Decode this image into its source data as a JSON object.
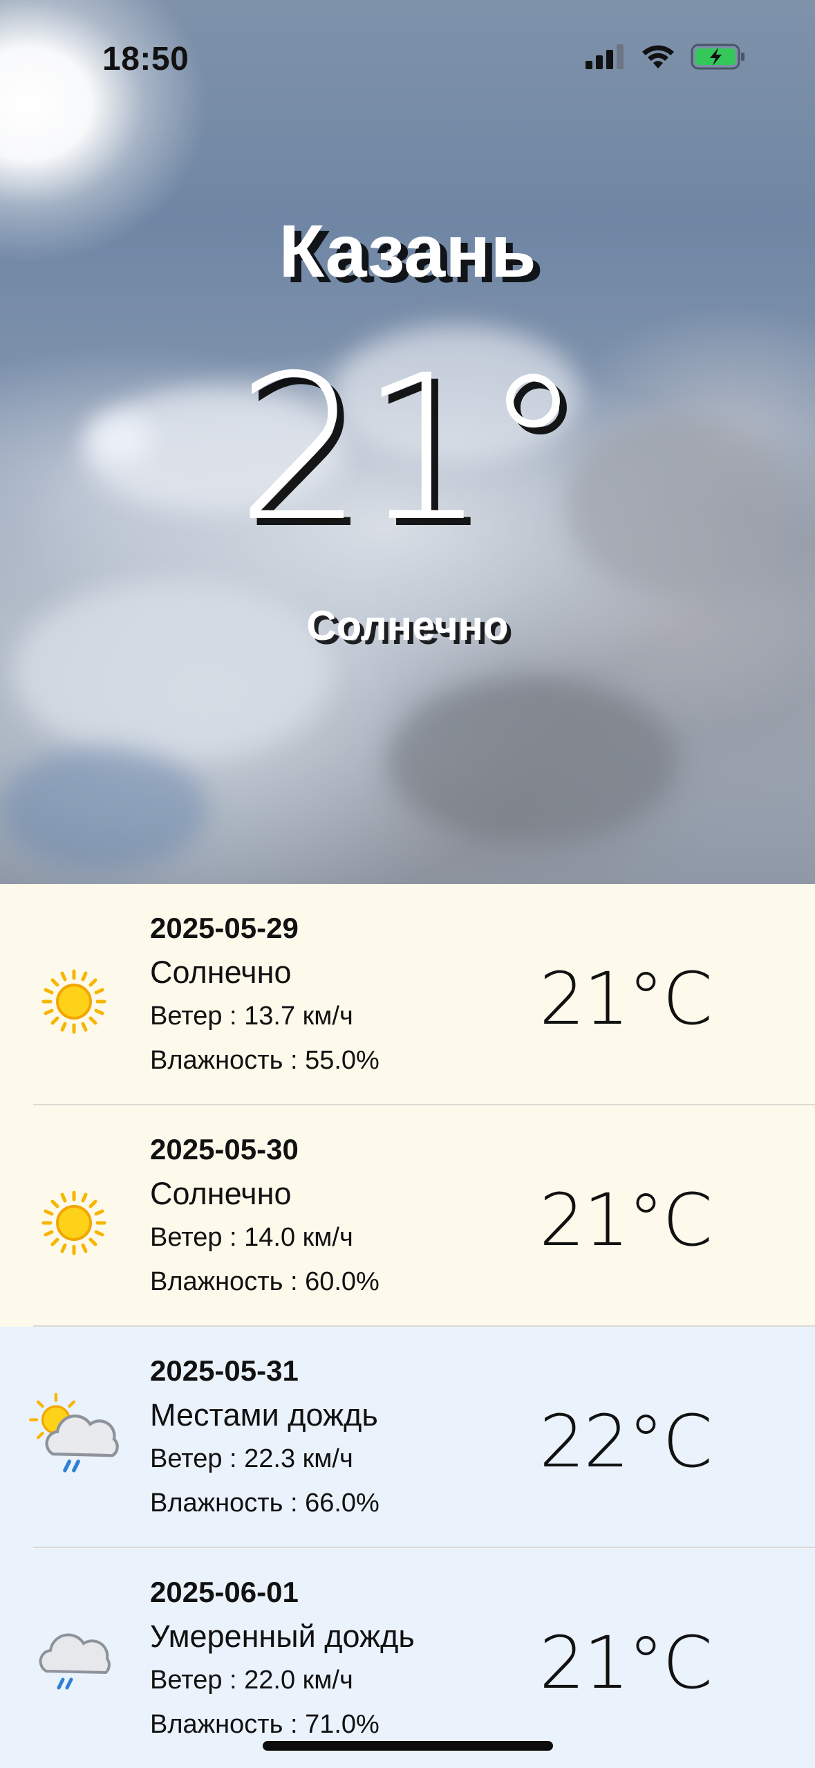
{
  "status_bar": {
    "time": "18:50"
  },
  "current": {
    "city": "Казань",
    "temperature": "21°",
    "condition": "Солнечно"
  },
  "forecast": [
    {
      "date": "2025-05-29",
      "condition": "Солнечно",
      "wind": "Ветер : 13.7 км/ч",
      "humidity": "Влажность : 55.0%",
      "temp": "21°C",
      "icon": "sun-icon"
    },
    {
      "date": "2025-05-30",
      "condition": "Солнечно",
      "wind": "Ветер : 14.0 км/ч",
      "humidity": "Влажность : 60.0%",
      "temp": "21°C",
      "icon": "sun-icon"
    },
    {
      "date": "2025-05-31",
      "condition": "Местами дождь",
      "wind": "Ветер : 22.3 км/ч",
      "humidity": "Влажность : 66.0%",
      "temp": "22°C",
      "icon": "sun-cloud-rain-icon"
    },
    {
      "date": "2025-06-01",
      "condition": "Умеренный дождь",
      "wind": "Ветер : 22.0 км/ч",
      "humidity": "Влажность : 71.0%",
      "temp": "21°C",
      "icon": "cloud-rain-icon"
    }
  ],
  "colors": {
    "sunny_row": "#fdfaec",
    "rainy_row": "#eaf2fc",
    "sun_yellow": "#f7b500",
    "battery_green": "#34c759"
  }
}
